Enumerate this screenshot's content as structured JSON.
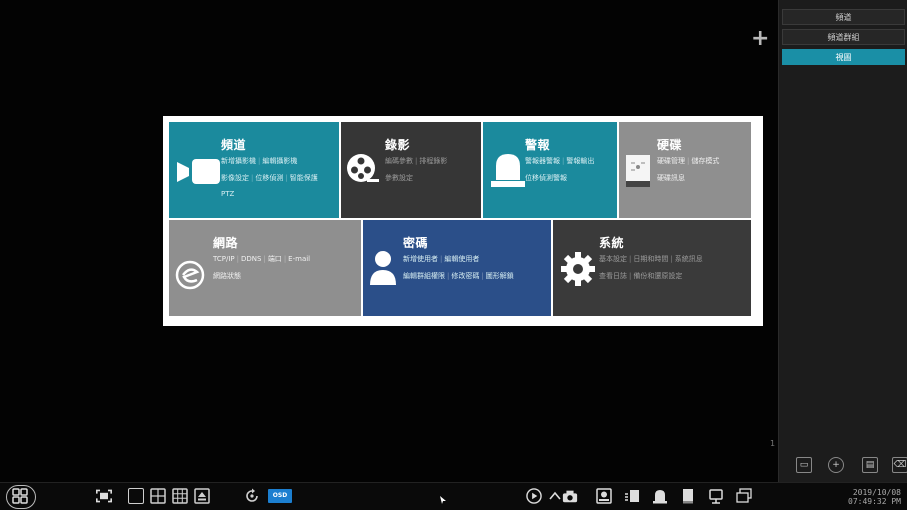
{
  "sidebar": {
    "tabs": [
      {
        "label": "頻道"
      },
      {
        "label": "頻道群組"
      },
      {
        "label": "視圖"
      }
    ],
    "page_number": "1"
  },
  "menu": {
    "channel": {
      "title": "頻道",
      "lines": [
        [
          "新增攝影機",
          "編輯攝影機"
        ],
        [
          "影像設定",
          "位移偵測",
          "智能保護"
        ],
        [
          "PTZ"
        ]
      ],
      "color": "#1b8a9d"
    },
    "record": {
      "title": "錄影",
      "lines": [
        [
          "編碼參數",
          "排程錄影"
        ],
        [
          "參數設定"
        ]
      ],
      "color": "#363636"
    },
    "alarm": {
      "title": "警報",
      "lines": [
        [
          "警報器警報",
          "警報輸出"
        ],
        [
          "位移偵測警報"
        ]
      ],
      "color": "#1b8a9d"
    },
    "disk": {
      "title": "硬碟",
      "lines": [
        [
          "硬碟管理",
          "儲存模式"
        ],
        [
          "硬碟訊息"
        ]
      ],
      "color": "#8f8f8f"
    },
    "network": {
      "title": "網路",
      "lines": [
        [
          "TCP/IP",
          "DDNS",
          "端口",
          "E-mail"
        ],
        [
          "網路狀態"
        ]
      ],
      "color": "#8f8f8f"
    },
    "account": {
      "title": "密碼",
      "lines": [
        [
          "新增使用者",
          "編輯使用者"
        ],
        [
          "編輯群組權限",
          "修改密碼",
          "圖形解鎖"
        ]
      ],
      "color": "#2b4f89"
    },
    "system": {
      "title": "系統",
      "lines": [
        [
          "基本設定",
          "日期和時間",
          "系統訊息"
        ],
        [
          "查看日誌",
          "備份和還原設定"
        ]
      ],
      "color": "#3a3a3a"
    }
  },
  "taskbar": {
    "osd_label": "OSD",
    "date": "2019/10/08",
    "time": "07:49:32 PM"
  }
}
